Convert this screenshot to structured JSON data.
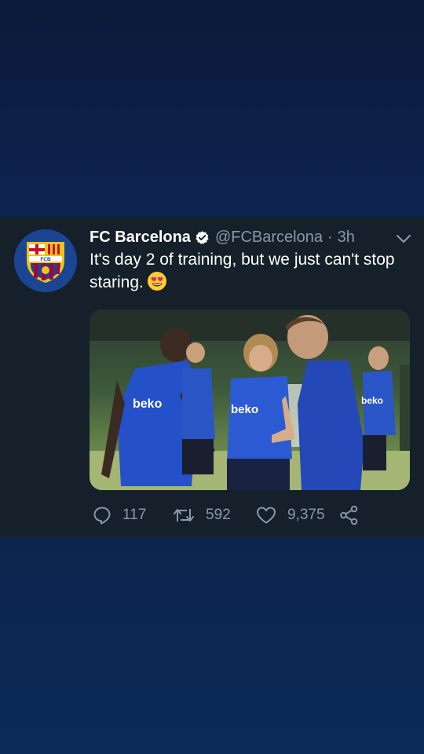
{
  "tweet": {
    "author_name": "FC Barcelona",
    "handle": "@FCBarcelona",
    "separator": "·",
    "time": "3h",
    "text": "It's day 2 of training, but we just can't stop staring.",
    "emoji": "heart-eyes-emoji",
    "verified": true,
    "avatar_logo_text": "FCB",
    "media": {
      "description_icon": "photo",
      "shirt_sponsor": "beko"
    },
    "actions": {
      "replies": "117",
      "retweets": "592",
      "likes": "9,375"
    }
  },
  "colors": {
    "card_bg": "#15202b",
    "secondary_text": "#8899a6",
    "primary_text": "#ffffff",
    "page_bg_top": "#0b1a3a",
    "page_bg_bottom": "#0b2a58"
  }
}
